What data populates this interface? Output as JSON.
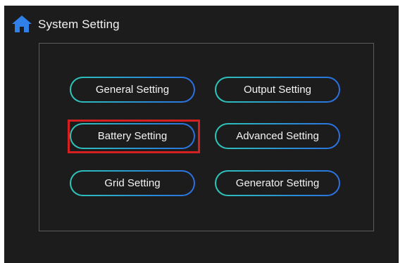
{
  "header": {
    "title": "System Setting",
    "home_icon": "home-icon"
  },
  "colors": {
    "background": "#1c1c1c",
    "home_icon": "#2f80e8",
    "button_border_start": "#2ec6b8",
    "button_border_end": "#2b6fe0",
    "panel_border": "#5c5c5c",
    "highlight": "#d42020"
  },
  "menu": {
    "general_setting": "General Setting",
    "output_setting": "Output Setting",
    "battery_setting": "Battery Setting",
    "advanced_setting": "Advanced Setting",
    "grid_setting": "Grid Setting",
    "generator_setting": "Generator Setting",
    "highlighted_item": "battery_setting"
  }
}
